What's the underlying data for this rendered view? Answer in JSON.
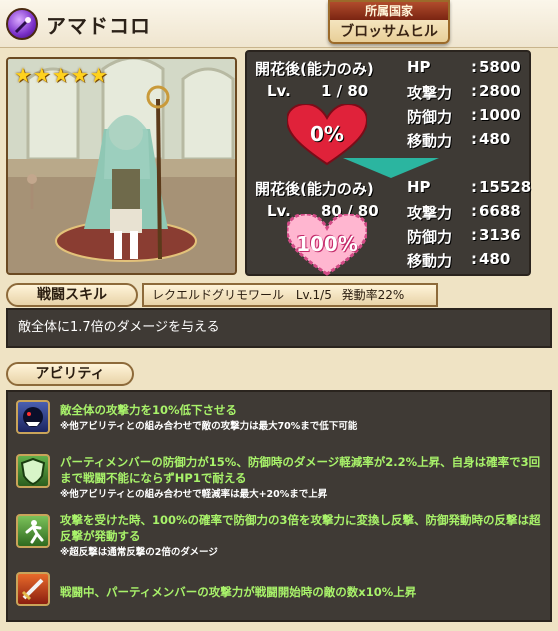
{
  "header": {
    "character_name": "アマドコロ",
    "nation_label": "所属国家",
    "nation_name": "ブロッサムヒル"
  },
  "portrait": {
    "stars": "★★★★★"
  },
  "stats_before": {
    "title": "開花後(能力のみ)",
    "level_label": "Lv.",
    "level_value": "1 / 80",
    "affection": "0%",
    "rows": [
      {
        "label": "HP",
        "value": "5800"
      },
      {
        "label": "攻撃力",
        "value": "2800"
      },
      {
        "label": "防御力",
        "value": "1000"
      },
      {
        "label": "移動力",
        "value": "480"
      }
    ]
  },
  "stats_after": {
    "title": "開花後(能力のみ)",
    "level_label": "Lv.",
    "level_value": "80 / 80",
    "affection": "100%",
    "rows": [
      {
        "label": "HP",
        "value": "15528"
      },
      {
        "label": "攻撃力",
        "value": "6688"
      },
      {
        "label": "防御力",
        "value": "3136"
      },
      {
        "label": "移動力",
        "value": "480"
      }
    ]
  },
  "battle_skill": {
    "tab_label": "戦闘スキル",
    "name": "レクエルドグリモワール",
    "level": "Lv.1/5",
    "rate": "発動率22%",
    "description": "敵全体に1.7倍のダメージを与える"
  },
  "abilities": {
    "tab_label": "アビリティ",
    "items": [
      {
        "icon": "debuff-monster-icon",
        "main": "敵全体の攻撃力を10%低下させる",
        "note": "※他アビリティとの組み合わせで敵の攻撃力は最大70%まで低下可能"
      },
      {
        "icon": "shield-icon",
        "main": "パーティメンバーの防御力が15%、防御時のダメージ軽減率が2.2%上昇、自身は確率で3回まで戦闘不能にならずHP1で耐える",
        "note": "※他アビリティとの組み合わせで軽減率は最大+20%まで上昇"
      },
      {
        "icon": "counter-icon",
        "main": "攻撃を受けた時、100%の確率で防御力の3倍を攻撃力に変換し反撃、防御発動時の反撃は超反撃が発動する",
        "note": "※超反撃は通常反撃の2倍のダメージ"
      },
      {
        "icon": "sword-icon",
        "main": "戦闘中、パーティメンバーの攻撃力が戦闘開始時の敵の数x10%上昇",
        "note": ""
      }
    ]
  },
  "colors": {
    "ability_text": "#a8f26a",
    "panel_bg": "#3f3a35",
    "heart": "#e0223a"
  }
}
